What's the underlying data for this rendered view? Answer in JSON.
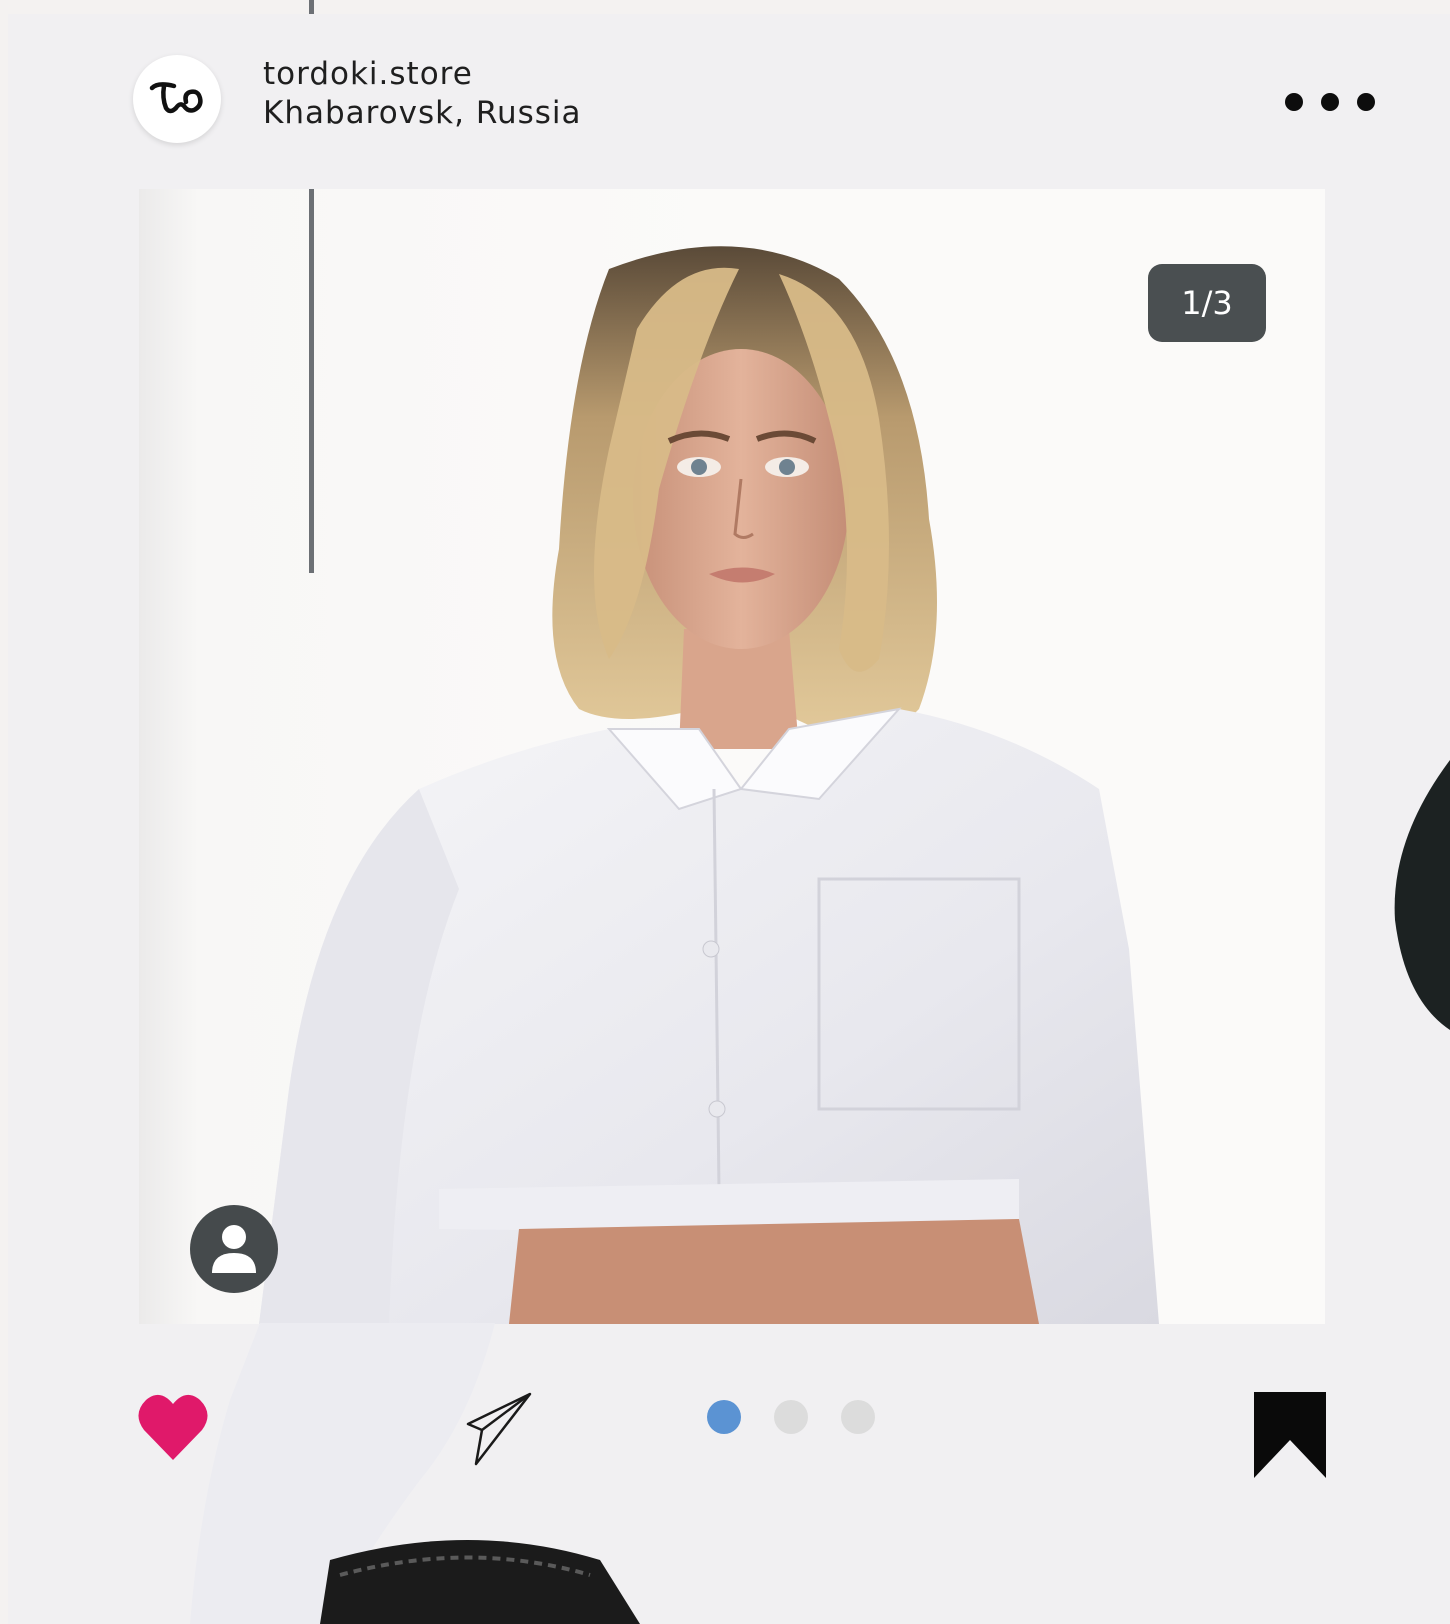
{
  "post": {
    "account_name": "tordoki.store",
    "location": "Khabarovsk, Russia",
    "avatar_logo_text": "To",
    "counter": "1/3",
    "carousel": {
      "total": 3,
      "active_index": 0
    }
  },
  "icons": {
    "more": "more-horizontal-icon",
    "tag": "user-tag-icon",
    "like": "heart-icon",
    "share": "paper-plane-icon",
    "save": "bookmark-icon"
  },
  "colors": {
    "like": "#e0196a",
    "active_dot": "#5b93d3",
    "inactive_dot": "#dcdcdc",
    "counter_bg": "#4a4f51",
    "card_bg": "#f1f0f2"
  }
}
